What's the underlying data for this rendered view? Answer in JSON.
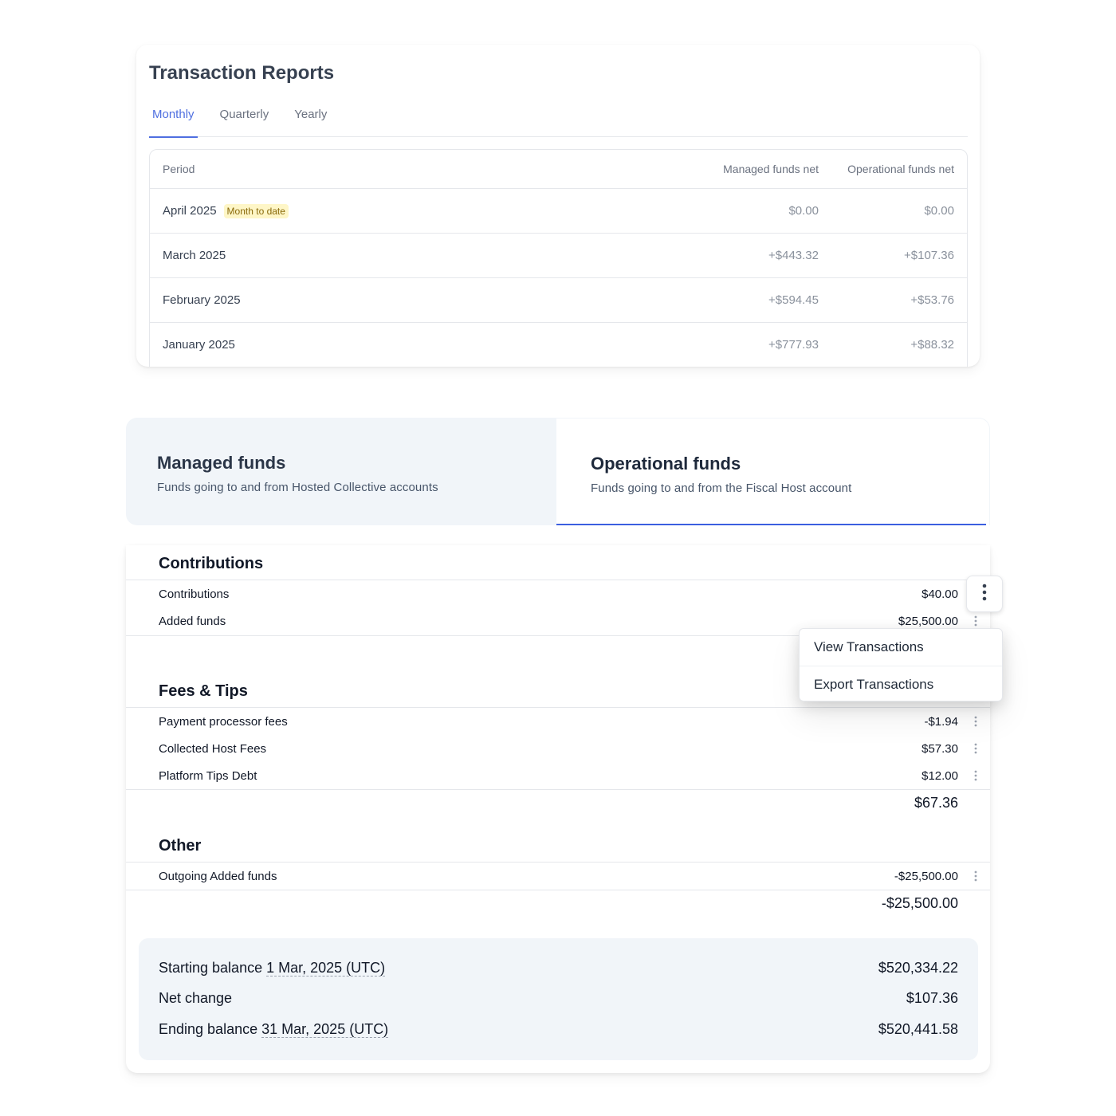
{
  "reports": {
    "title": "Transaction Reports",
    "tabs": [
      {
        "label": "Monthly",
        "active": true
      },
      {
        "label": "Quarterly",
        "active": false
      },
      {
        "label": "Yearly",
        "active": false
      }
    ],
    "columns": {
      "period": "Period",
      "managed": "Managed funds net",
      "operational": "Operational funds net"
    },
    "rows": [
      {
        "period": "April 2025",
        "badge": "Month to date",
        "managed": "$0.00",
        "operational": "$0.00"
      },
      {
        "period": "March 2025",
        "managed": "+$443.32",
        "operational": "+$107.36"
      },
      {
        "period": "February 2025",
        "managed": "+$594.45",
        "operational": "+$53.76"
      },
      {
        "period": "January 2025",
        "managed": "+$777.93",
        "operational": "+$88.32"
      }
    ]
  },
  "fund_tabs": {
    "managed": {
      "title": "Managed funds",
      "subtitle": "Funds going to and from Hosted Collective accounts"
    },
    "operational": {
      "title": "Operational funds",
      "subtitle": "Funds going to and from the Fiscal Host account",
      "active": true
    }
  },
  "breakdown": {
    "contributions": {
      "title": "Contributions",
      "lines": [
        {
          "label": "Contributions",
          "amount": "$40.00"
        },
        {
          "label": "Added funds",
          "amount": "$25,500.00"
        }
      ]
    },
    "fees": {
      "title": "Fees & Tips",
      "lines": [
        {
          "label": "Payment processor fees",
          "amount": "-$1.94"
        },
        {
          "label": "Collected Host Fees",
          "amount": "$57.30"
        },
        {
          "label": "Platform Tips Debt",
          "amount": "$12.00"
        }
      ],
      "total": "$67.36"
    },
    "other": {
      "title": "Other",
      "lines": [
        {
          "label": "Outgoing Added funds",
          "amount": "-$25,500.00"
        }
      ],
      "total": "-$25,500.00"
    },
    "summary": {
      "starting_label": "Starting balance",
      "starting_date": "1 Mar, 2025 (UTC)",
      "starting_amount": "$520,334.22",
      "net_label": "Net change",
      "net_amount": "$107.36",
      "ending_label": "Ending balance",
      "ending_date": "31 Mar, 2025 (UTC)",
      "ending_amount": "$520,441.58"
    }
  },
  "menu": {
    "items": [
      {
        "label": "View Transactions"
      },
      {
        "label": "Export Transactions"
      }
    ]
  },
  "icons": {
    "row_actions": "kebab-icon",
    "menu_trigger": "kebab-icon"
  },
  "colors": {
    "accent": "#4f6fe0",
    "active_tab_underline": "#3b5fe0",
    "badge_bg": "#fef6c7",
    "panel_bg": "#f1f5f9"
  }
}
